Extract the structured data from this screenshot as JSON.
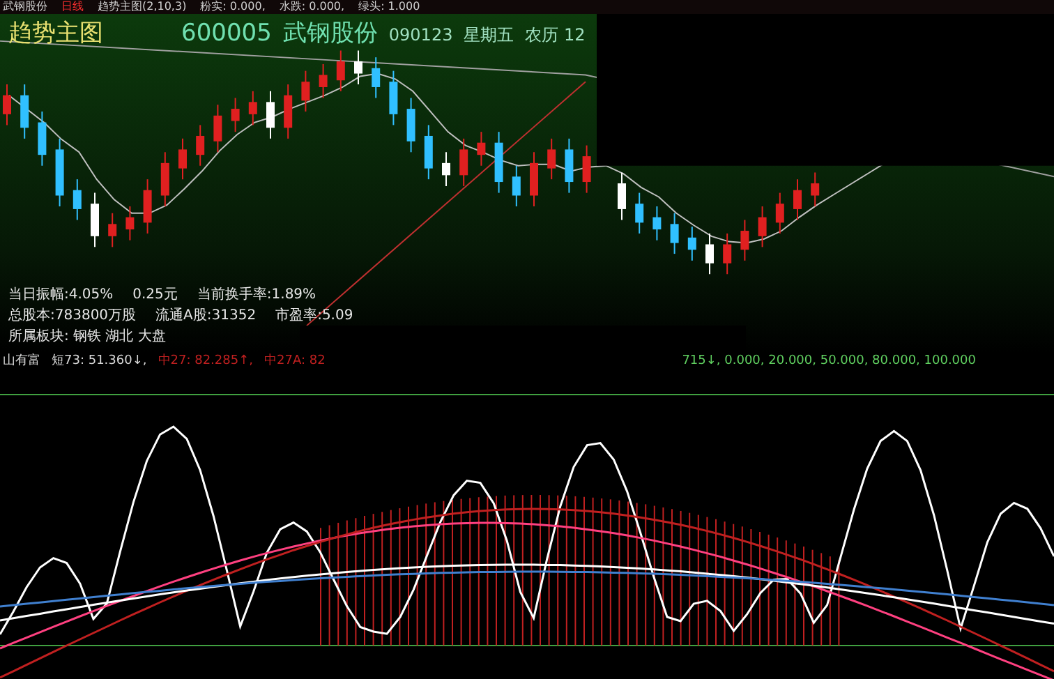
{
  "title_bar": {
    "items": [
      {
        "text": "武钢股份",
        "color": "#d0d0d0"
      },
      {
        "text": "日线",
        "color": "#ff3030"
      },
      {
        "text": "趋势主图(2,10,3)",
        "color": "#d0d0d0"
      },
      {
        "text": "粉实: 0.000,",
        "color": "#d0d0d0"
      },
      {
        "text": "水跌: 0.000,",
        "color": "#d0d0d0"
      },
      {
        "text": "绿头: 1.000",
        "color": "#d0d0d0"
      }
    ]
  },
  "main_chart": {
    "title": "趋势主图",
    "code": "600005",
    "name": "武钢股份",
    "date": "090123",
    "weekday": "星期五",
    "lunar": "农历 12"
  },
  "info_panel": {
    "lines": [
      [
        "当日振幅:4.05%",
        "0.25元",
        "当前换手率:1.89%"
      ],
      [
        "总股本:783800万股",
        "流通A股:31352",
        "市盈率:5.09"
      ],
      [
        "所属板块: 钢铁 湖北 大盘"
      ]
    ]
  },
  "indicator": {
    "name": "山有富",
    "values": [
      {
        "text": "短73: 51.360↓,",
        "color": "#d8d8d8"
      },
      {
        "text": "中27: 82.285↑,",
        "color": "#c02020"
      },
      {
        "text": "中27A: 82",
        "color": "#c02020"
      }
    ],
    "tail": "715↓, 0.000, 20.000, 50.000, 80.000, 100.000"
  }
}
